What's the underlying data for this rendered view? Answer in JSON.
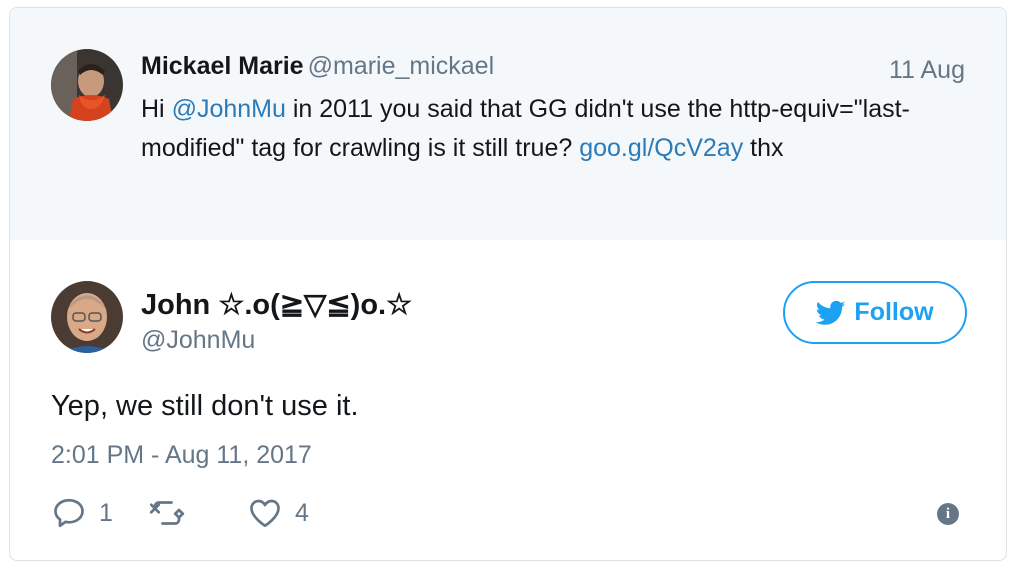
{
  "parent_tweet": {
    "author_name": "Mickael Marie",
    "author_handle": "@marie_mickael",
    "date": "11 Aug",
    "text_1": "Hi ",
    "mention": "@JohnMu",
    "text_2": " in 2011 you said that GG didn't use the http-equiv=\"last-modified\" tag for crawling is it still true? ",
    "link": "goo.gl/QcV2ay",
    "text_3": " thx"
  },
  "tweet": {
    "author_name": "John ☆.o(≧▽≦)o.☆",
    "author_handle": "@JohnMu",
    "follow_label": "Follow",
    "text": "Yep, we still don't use it.",
    "timestamp": "2:01 PM - Aug 11, 2017",
    "reply_count": "1",
    "retweet_count": "",
    "like_count": "4"
  },
  "icons": {
    "reply": "reply-icon",
    "retweet": "retweet-icon",
    "like": "heart-icon",
    "info": "info-icon",
    "follow": "twitter-bird-icon"
  },
  "colors": {
    "link": "#2b7bb9",
    "accent": "#1da1f2",
    "muted": "#657786",
    "parent_bg": "#f5f8fa"
  }
}
